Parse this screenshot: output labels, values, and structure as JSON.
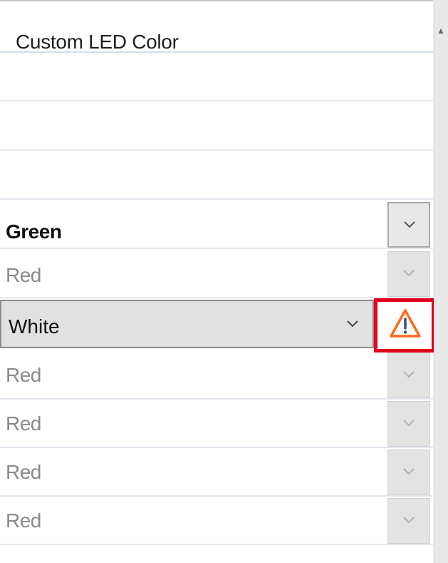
{
  "grid": {
    "header": "Custom LED Color",
    "rows": [
      {
        "value": ""
      },
      {
        "value": ""
      },
      {
        "value": ""
      },
      {
        "value": "Green",
        "state": "enabled"
      },
      {
        "value": "Red",
        "state": "disabled"
      },
      {
        "value": "White",
        "state": "editing",
        "warning": true
      },
      {
        "value": "Red",
        "state": "disabled"
      },
      {
        "value": "Red",
        "state": "disabled"
      },
      {
        "value": "Red",
        "state": "disabled"
      },
      {
        "value": "Red",
        "state": "disabled"
      }
    ]
  },
  "icons": {
    "dropdown": "chevron-down-icon",
    "warning": "warning-triangle-icon",
    "scroll_up": "scroll-up-arrow-icon"
  },
  "colors": {
    "warning_orange": "#ff6a1a",
    "highlight_red": "#e3001b",
    "disabled_text": "#8a8a8a"
  }
}
